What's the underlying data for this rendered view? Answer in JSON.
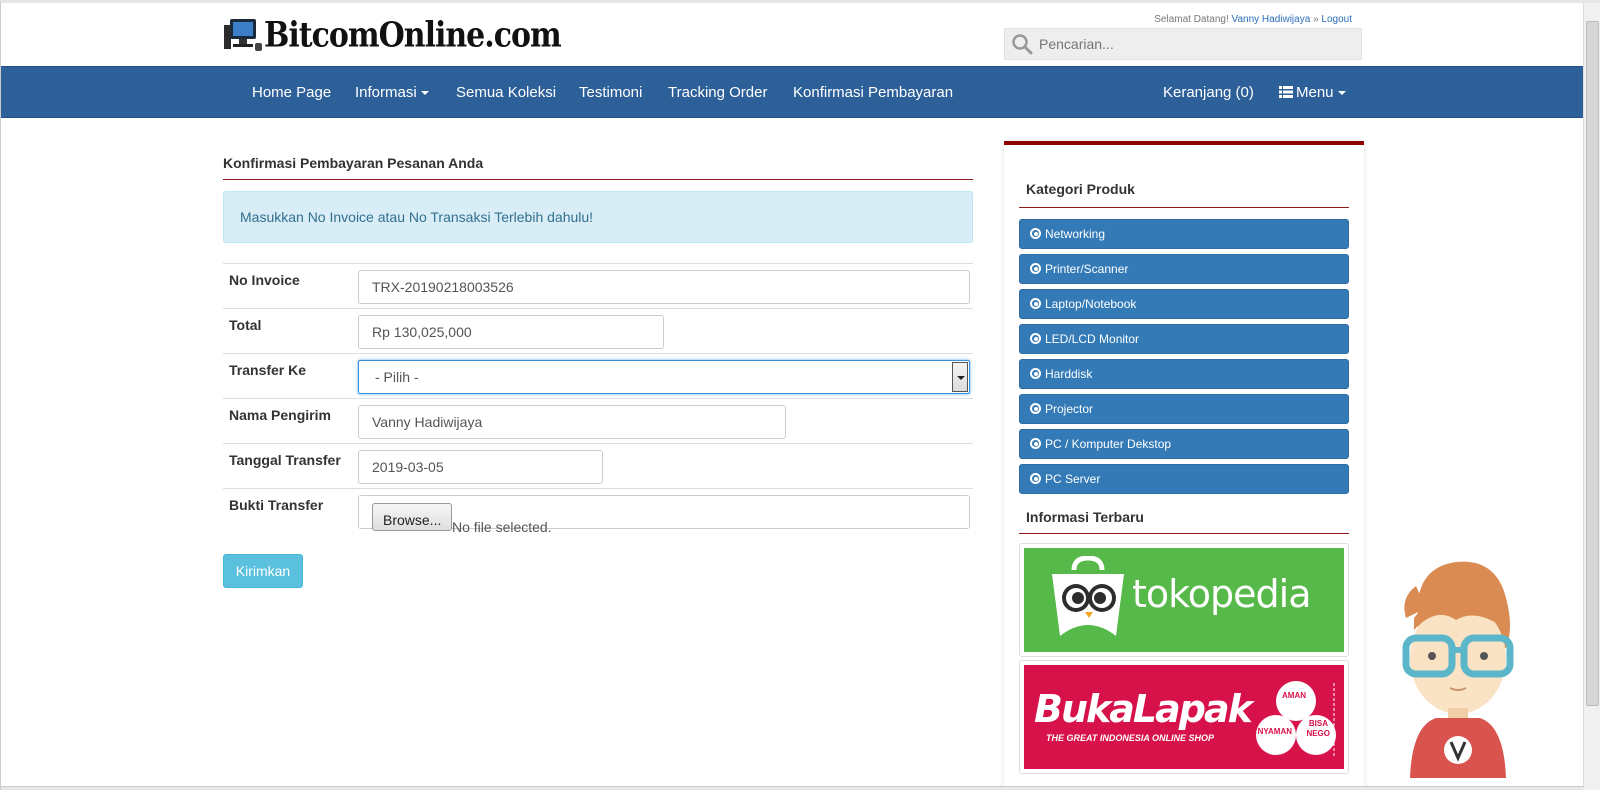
{
  "header": {
    "logo_text": "BitcomOnline.com",
    "welcome_prefix": "Selamat Datang!",
    "user_name": "Vanny Hadiwijaya",
    "separator": "»",
    "logout_label": "Logout",
    "search_placeholder": "Pencarian..."
  },
  "navbar": {
    "items": [
      {
        "label": "Home Page"
      },
      {
        "label": "Informasi"
      },
      {
        "label": "Semua Koleksi"
      },
      {
        "label": "Testimoni"
      },
      {
        "label": "Tracking Order"
      },
      {
        "label": "Konfirmasi Pembayaran"
      }
    ],
    "cart_label": "Keranjang (0)",
    "menu_label": "Menu"
  },
  "main": {
    "title": "Konfirmasi Pembayaran Pesanan Anda",
    "alert": "Masukkan No Invoice atau No Transaksi Terlebih dahulu!",
    "form": {
      "invoice_label": "No Invoice",
      "invoice_value": "TRX-20190218003526",
      "total_label": "Total",
      "total_value": "Rp 130,025,000",
      "transfer_label": "Transfer Ke",
      "transfer_value": "- Pilih -",
      "sender_label": "Nama Pengirim",
      "sender_value": "Vanny Hadiwijaya",
      "date_label": "Tanggal Transfer",
      "date_value": "2019-03-05",
      "proof_label": "Bukti Transfer",
      "browse_label": "Browse...",
      "file_status": "No file selected."
    },
    "submit_label": "Kirimkan"
  },
  "sidebar": {
    "category_title": "Kategori Produk",
    "categories": [
      "Networking",
      "Printer/Scanner",
      "Laptop/Notebook",
      "LED/LCD Monitor",
      "Harddisk",
      "Projector",
      "PC / Komputer Dekstop",
      "PC Server"
    ],
    "info_title": "Informasi Terbaru",
    "banners": {
      "tokopedia": "tokopedia",
      "bukalapak": "BukaLapak",
      "bukalapak_tagline": "THE GREAT INDONESIA ONLINE SHOP",
      "badge_words": [
        "AMAN",
        "BISA",
        "NEGO",
        "NYAMAN"
      ]
    }
  },
  "colors": {
    "navbar": "#2d5f99",
    "accent_red": "#8b0000",
    "category_button": "#337ab7",
    "alert_bg": "#d9edf7",
    "submit": "#5bc0de"
  }
}
